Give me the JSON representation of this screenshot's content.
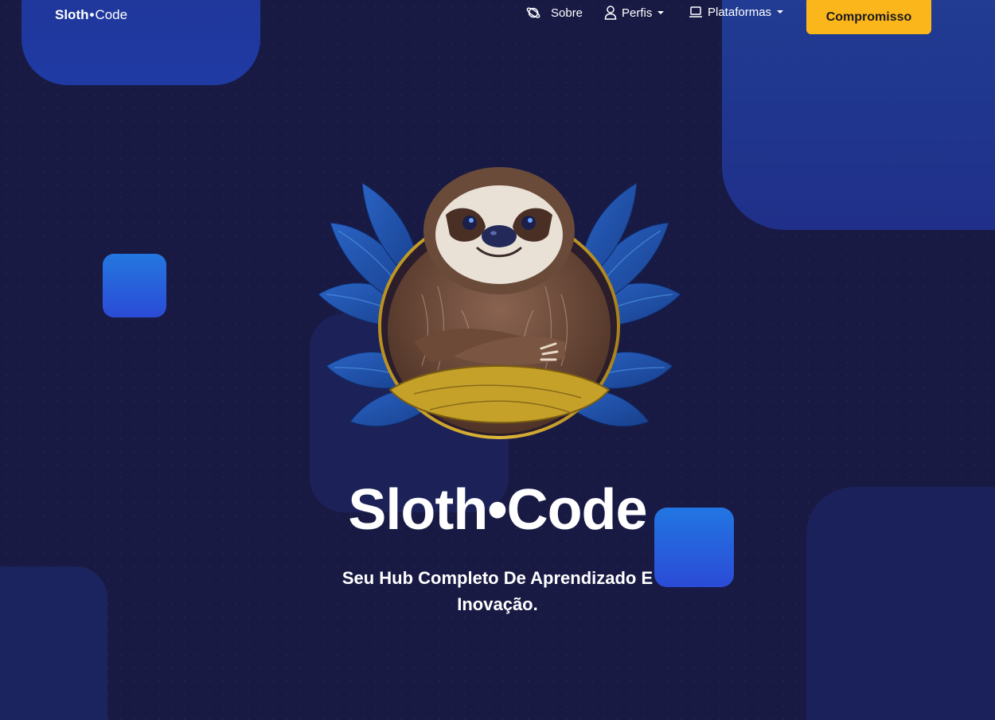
{
  "brand": {
    "bold": "Sloth",
    "dot": "•",
    "light": "Code"
  },
  "nav": {
    "items": [
      {
        "label": "Sobre",
        "icon": "planet-icon",
        "dropdown": false
      },
      {
        "label": "Perfis",
        "icon": "user-icon",
        "dropdown": true
      },
      {
        "label": "Plataformas",
        "icon": "laptop-icon",
        "dropdown": true
      }
    ],
    "cta_label": "Compromisso"
  },
  "hero": {
    "image_icon": "sloth-mascot-illustration",
    "title": "Sloth•Code",
    "subtitle": "Seu Hub Completo De Aprendizado E Inovação."
  },
  "colors": {
    "background": "#181a44",
    "accent_blue": "#2b4bd6",
    "cta": "#fbb61b",
    "leaf": "#1f4ea8",
    "gold": "#d2a62a",
    "fur": "#6b4a36"
  }
}
